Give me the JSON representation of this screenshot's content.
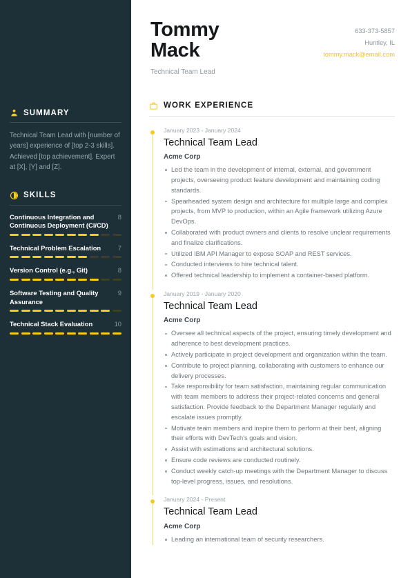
{
  "theme": {
    "sidebar_bg": "#1d2f37",
    "accent": "#f5cb1e",
    "page_bg": "#ffffff"
  },
  "header": {
    "name": "Tommy Mack",
    "job_title": "Technical Team Lead",
    "contacts": [
      {
        "icon": "phone-icon",
        "text": "633-373-5857",
        "kind": "phone"
      },
      {
        "icon": "location-icon",
        "text": "Huntley, IL",
        "kind": "location"
      },
      {
        "icon": "email-icon",
        "text": "tommy.mack@email.com",
        "kind": "email"
      }
    ]
  },
  "sidebar": {
    "summary": {
      "icon": "user-icon",
      "title": "SUMMARY",
      "text": "Technical Team Lead with [number of years] experience of [top 2-3 skills]. Achieved [top achievement]. Expert at [X], [Y] and [Z]."
    },
    "skills": {
      "icon": "skill-gauge-icon",
      "title": "SKILLS",
      "max": 10,
      "items": [
        {
          "name": "Continuous Integration and Continuous Deployment (CI/CD)",
          "score": 8
        },
        {
          "name": "Technical Problem Escalation",
          "score": 7
        },
        {
          "name": "Version Control (e.g., Git)",
          "score": 8
        },
        {
          "name": "Software Testing and Quality Assurance",
          "score": 9
        },
        {
          "name": "Technical Stack Evaluation",
          "score": 10
        }
      ]
    }
  },
  "main": {
    "work_experience": {
      "icon": "briefcase-icon",
      "title": "WORK EXPERIENCE",
      "jobs": [
        {
          "date": "January 2023 - January 2024",
          "role": "Technical Team Lead",
          "company": "Acme Corp",
          "bullets": [
            "Led the team in the development of internal, external, and government projects, overseeing product feature development and maintaining coding standards.",
            "Spearheaded system design and architecture for multiple large and complex projects, from MVP to production, within an Agile framework utilizing Azure DevOps.",
            "Collaborated with product owners and clients to resolve unclear requirements and finalize clarifications.",
            "Utilized IBM API Manager to expose SOAP and REST services.",
            "Conducted interviews to hire technical talent.",
            "Offered technical leadership to implement a container-based platform."
          ]
        },
        {
          "date": "January 2019 - January 2020",
          "role": "Technical Team Lead",
          "company": "Acme Corp",
          "bullets": [
            "Oversee all technical aspects of the project, ensuring timely development and adherence to best development practices.",
            "Actively participate in project development and organization within the team.",
            "Contribute to project planning, collaborating with customers to enhance our delivery processes.",
            "Take responsibility for team satisfaction, maintaining regular communication with team members to address their project-related concerns and general satisfaction. Provide feedback to the Department Manager regularly and escalate issues promptly.",
            "Motivate team members and inspire them to perform at their best, aligning their efforts with DevTech's goals and vision.",
            "Assist with estimations and architectural solutions.",
            "Ensure code reviews are conducted routinely.",
            "Conduct weekly catch-up meetings with the Department Manager to discuss top-level progress, issues, and resolutions."
          ]
        },
        {
          "date": "January 2024 - Present",
          "role": "Technical Team Lead",
          "company": "Acme Corp",
          "bullets": [
            "Leading an international team of security researchers."
          ]
        }
      ]
    }
  }
}
